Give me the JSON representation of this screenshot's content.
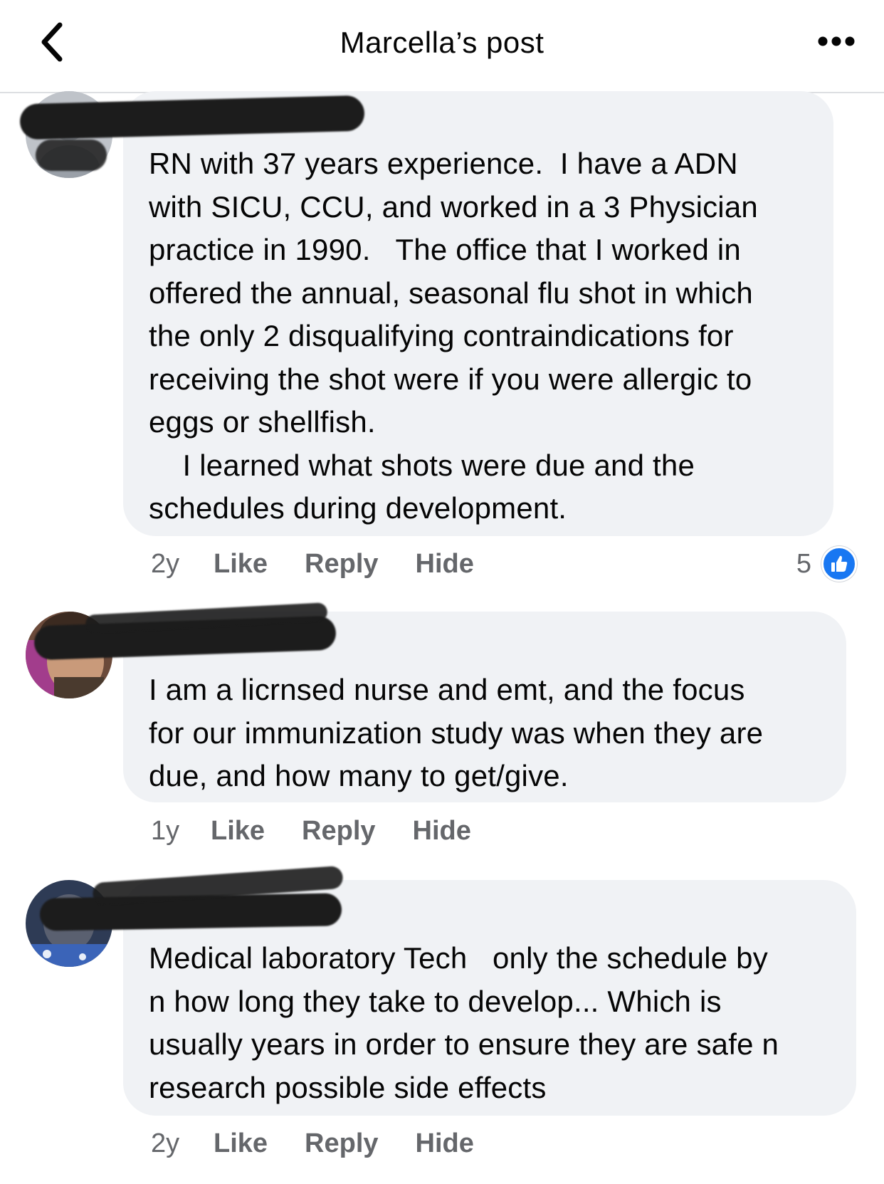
{
  "header": {
    "title": "Marcella’s post",
    "back_icon": "chevron-left-icon",
    "more_icon": "more-horizontal-icon"
  },
  "comments": [
    {
      "text": "RN with 37 years experience.  I have a ADN\nwith SICU, CCU, and worked in a 3 Physician\npractice in 1990.   The office that I worked in\noffered the annual, seasonal flu shot in which\nthe only 2 disqualifying contraindications for\nreceiving the shot were if you were allergic to\neggs or shellfish.\n    I learned what shots were due and the\nschedules during development.",
      "time": "2y",
      "like_label": "Like",
      "reply_label": "Reply",
      "hide_label": "Hide",
      "reaction_count": "5",
      "reaction_icon": "thumbs-up-icon"
    },
    {
      "text": "I am a licrnsed nurse and emt, and the focus\nfor our immunization study was when they are\ndue, and how many to get/give.",
      "time": "1y",
      "like_label": "Like",
      "reply_label": "Reply",
      "hide_label": "Hide"
    },
    {
      "text": "Medical laboratory Tech   only the schedule by\nn how long they take to develop... Which is\nusually years in order to ensure they are safe n\nresearch possible side effects",
      "time": "2y",
      "like_label": "Like",
      "reply_label": "Reply",
      "hide_label": "Hide"
    }
  ],
  "colors": {
    "bubble": "#f0f2f5",
    "meta_text": "#65676b",
    "like_blue": "#1877f2",
    "divider": "#dddfe2"
  }
}
